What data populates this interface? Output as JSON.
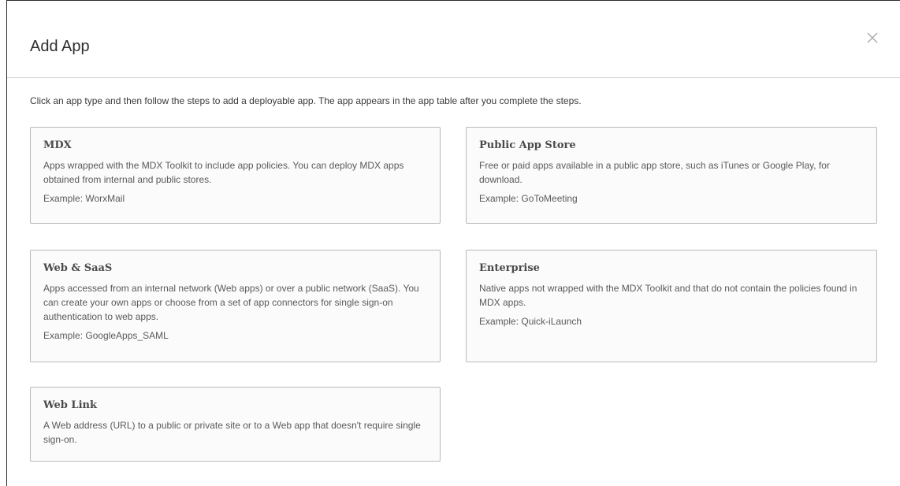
{
  "dialog": {
    "title": "Add App",
    "intro": "Click an app type and then follow the steps to add a deployable app. The app appears in the app table after you complete the steps."
  },
  "cards": [
    {
      "title": "MDX",
      "description": "Apps wrapped with the MDX Toolkit to include app policies. You can deploy MDX apps obtained from internal and public stores.",
      "example": "Example: WorxMail"
    },
    {
      "title": "Public App Store",
      "description": "Free or paid apps available in a public app store, such as iTunes or Google Play, for download.",
      "example": "Example: GoToMeeting"
    },
    {
      "title": "Web & SaaS",
      "description": "Apps accessed from an internal network (Web apps) or over a public network (SaaS). You can create your own apps or choose from a set of app connectors for single sign-on authentication to web apps.",
      "example": "Example: GoogleApps_SAML"
    },
    {
      "title": "Enterprise",
      "description": "Native apps not wrapped with the MDX Toolkit and that do not contain the policies found in MDX apps.",
      "example": "Example: Quick-iLaunch"
    },
    {
      "title": "Web Link",
      "description": "A Web address (URL) to a public or private site or to a Web app that doesn't require single sign-on."
    }
  ],
  "icons": {
    "close": "close-icon"
  }
}
